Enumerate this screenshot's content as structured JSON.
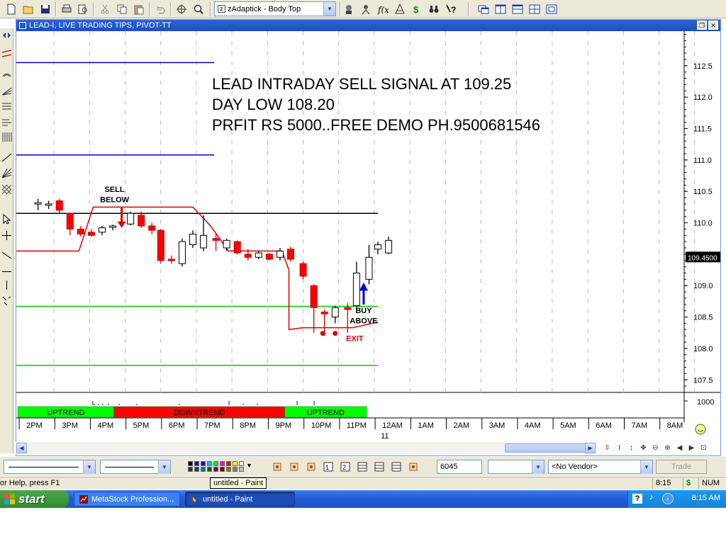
{
  "toolbar": {
    "template_value": "zAdaptick - Body Top",
    "icons": [
      "new-icon",
      "open-icon",
      "save-icon",
      "print-icon",
      "print-preview-icon",
      "cut-icon",
      "copy-icon",
      "paste-icon",
      "undo-icon",
      "crosshair-icon",
      "zoom-icon",
      "template-icon",
      "expert-advisor-icon",
      "explorer-icon",
      "indicator-builder-icon",
      "system-tester-icon",
      "dollar-icon",
      "binoculars-icon",
      "help-icon",
      "window-cascade-icon",
      "tile-vertical-icon",
      "tile-horizontal-icon",
      "tile-grid-icon",
      "layout-icon"
    ]
  },
  "chart_window": {
    "title": "LEAD-I, LIVE TRADING TIPS, PIVOT-TT"
  },
  "chart_data": {
    "type": "candlestick",
    "annotation_lines": [
      "LEAD INTRADAY SELL SIGNAL AT 109.25",
      "DAY LOW 108.20",
      "PRFIT RS 5000..FREE DEMO PH.9500681546"
    ],
    "sell_label_line1": "SELL",
    "sell_label_line2": "BELOW",
    "buy_label_line1": "BUY",
    "buy_label_line2": "ABOVE",
    "exit_label": "EXIT",
    "y_ticks": [
      "112.5",
      "112.0",
      "111.5",
      "111.0",
      "110.5",
      "110.0",
      "109.5",
      "109.0",
      "108.5",
      "108.0",
      "107.5"
    ],
    "y_tick_values": [
      112.5,
      112.0,
      111.5,
      111.0,
      110.5,
      110.0,
      109.5,
      109.0,
      108.5,
      108.0,
      107.5
    ],
    "ylim": [
      107.3,
      113.05
    ],
    "last_price": "109.4500",
    "last_price_value": 109.45,
    "volume_label": "1000",
    "x_ticks": [
      "2PM",
      "3PM",
      "4PM",
      "5PM",
      "6PM",
      "7PM",
      "8PM",
      "9PM",
      "10PM",
      "11PM",
      "12AM",
      "1AM",
      "2AM",
      "3AM",
      "4AM",
      "5AM",
      "6AM",
      "7AM",
      "8AM"
    ],
    "date_label": "11",
    "trend_segments": [
      {
        "label": "UPTREND",
        "color": "#00ff00",
        "from_hour": 14.0,
        "to_hour": 16.7
      },
      {
        "label": "DOWNTREND",
        "color": "#ff0000",
        "from_hour": 16.7,
        "to_hour": 21.5
      },
      {
        "label": "UPTREND",
        "color": "#00ff00",
        "from_hour": 21.5,
        "to_hour": 23.8
      }
    ],
    "horizontal_levels": [
      {
        "value": 112.55,
        "color": "#0000cc",
        "to_hour": 19.0
      },
      {
        "value": 111.08,
        "color": "#0000cc",
        "to_hour": 19.0
      },
      {
        "value": 110.15,
        "color": "#000000",
        "to_hour": 23.6
      },
      {
        "value": 108.67,
        "color": "#00cc00",
        "to_hour": 23.6
      },
      {
        "value": 107.73,
        "color": "#00cc00",
        "to_hour": 23.6
      }
    ],
    "stop_line": [
      [
        13.0,
        109.55
      ],
      [
        15.2,
        109.55
      ],
      [
        15.6,
        110.25
      ],
      [
        18.4,
        110.25
      ],
      [
        18.9,
        109.95
      ],
      [
        19.4,
        109.55
      ],
      [
        20.9,
        109.55
      ],
      [
        21.1,
        109.25
      ],
      [
        21.1,
        108.3
      ],
      [
        21.5,
        108.33
      ],
      [
        22.2,
        108.33
      ],
      [
        22.9,
        108.33
      ],
      [
        23.6,
        108.42
      ]
    ],
    "candles": [
      {
        "t": 14.05,
        "o": 110.3,
        "h": 110.38,
        "l": 110.2,
        "c": 110.32
      },
      {
        "t": 14.35,
        "o": 110.3,
        "h": 110.35,
        "l": 110.22,
        "c": 110.3
      },
      {
        "t": 14.65,
        "o": 110.35,
        "h": 110.38,
        "l": 110.15,
        "c": 110.2
      },
      {
        "t": 14.95,
        "o": 110.15,
        "h": 110.16,
        "l": 109.8,
        "c": 109.9
      },
      {
        "t": 15.25,
        "o": 109.9,
        "h": 109.95,
        "l": 109.78,
        "c": 109.82
      },
      {
        "t": 15.55,
        "o": 109.85,
        "h": 109.9,
        "l": 109.78,
        "c": 109.8
      },
      {
        "t": 15.85,
        "o": 109.85,
        "h": 109.95,
        "l": 109.8,
        "c": 109.92
      },
      {
        "t": 16.15,
        "o": 109.93,
        "h": 109.97,
        "l": 109.88,
        "c": 109.95
      },
      {
        "t": 16.65,
        "o": 109.98,
        "h": 110.18,
        "l": 109.96,
        "c": 110.15
      },
      {
        "t": 16.95,
        "o": 110.12,
        "h": 110.18,
        "l": 109.92,
        "c": 109.95
      },
      {
        "t": 17.25,
        "o": 109.95,
        "h": 110.0,
        "l": 109.82,
        "c": 109.88
      },
      {
        "t": 17.5,
        "o": 109.88,
        "h": 109.9,
        "l": 109.35,
        "c": 109.4
      },
      {
        "t": 17.8,
        "o": 109.42,
        "h": 109.48,
        "l": 109.35,
        "c": 109.4
      },
      {
        "t": 18.1,
        "o": 109.35,
        "h": 109.75,
        "l": 109.3,
        "c": 109.7
      },
      {
        "t": 18.4,
        "o": 109.65,
        "h": 109.88,
        "l": 109.6,
        "c": 109.82
      },
      {
        "t": 18.7,
        "o": 109.6,
        "h": 110.12,
        "l": 109.55,
        "c": 109.8
      },
      {
        "t": 19.05,
        "o": 109.75,
        "h": 109.82,
        "l": 109.55,
        "c": 109.72
      },
      {
        "t": 19.35,
        "o": 109.6,
        "h": 109.75,
        "l": 109.55,
        "c": 109.72
      },
      {
        "t": 19.65,
        "o": 109.7,
        "h": 109.72,
        "l": 109.5,
        "c": 109.52
      },
      {
        "t": 19.95,
        "o": 109.5,
        "h": 109.58,
        "l": 109.4,
        "c": 109.45
      },
      {
        "t": 20.25,
        "o": 109.45,
        "h": 109.55,
        "l": 109.42,
        "c": 109.52
      },
      {
        "t": 20.55,
        "o": 109.5,
        "h": 109.52,
        "l": 109.4,
        "c": 109.42
      },
      {
        "t": 20.85,
        "o": 109.45,
        "h": 109.6,
        "l": 109.4,
        "c": 109.55
      },
      {
        "t": 21.15,
        "o": 109.58,
        "h": 109.62,
        "l": 109.38,
        "c": 109.42
      },
      {
        "t": 21.5,
        "o": 109.35,
        "h": 109.38,
        "l": 109.1,
        "c": 109.15
      },
      {
        "t": 21.8,
        "o": 109.0,
        "h": 109.02,
        "l": 108.25,
        "c": 108.65
      },
      {
        "t": 22.1,
        "o": 108.58,
        "h": 108.62,
        "l": 108.2,
        "c": 108.55
      },
      {
        "t": 22.4,
        "o": 108.5,
        "h": 108.68,
        "l": 108.4,
        "c": 108.65
      },
      {
        "t": 22.75,
        "o": 108.65,
        "h": 108.72,
        "l": 108.25,
        "c": 108.62
      },
      {
        "t": 23.0,
        "o": 108.68,
        "h": 109.38,
        "l": 108.65,
        "c": 109.2
      },
      {
        "t": 23.35,
        "o": 109.1,
        "h": 109.65,
        "l": 109.02,
        "c": 109.45
      },
      {
        "t": 23.6,
        "o": 109.58,
        "h": 109.7,
        "l": 109.5,
        "c": 109.65
      },
      {
        "t": 23.9,
        "o": 109.52,
        "h": 109.78,
        "l": 109.5,
        "c": 109.72
      }
    ]
  },
  "bottombar": {
    "bar_count": "6045",
    "vendor": "<No Vendor>",
    "trade_label": "Trade"
  },
  "statusbar": {
    "help_text": "or Help, press F1",
    "tooltip": "untitled - Paint",
    "time": "8:15",
    "num": "NUM"
  },
  "taskbar": {
    "start_label": "start",
    "tasks": [
      "MetaStock Profession...",
      "untitled - Paint"
    ],
    "clock": "8:15 AM"
  },
  "colors": {
    "bull_candle": "#ffffff",
    "bear_candle": "#ff0000",
    "stop_line": "#dd0000",
    "uptrend": "#00ff00",
    "downtrend": "#ff0000",
    "taskbar": "#245edb",
    "start": "#3c9b3c"
  }
}
